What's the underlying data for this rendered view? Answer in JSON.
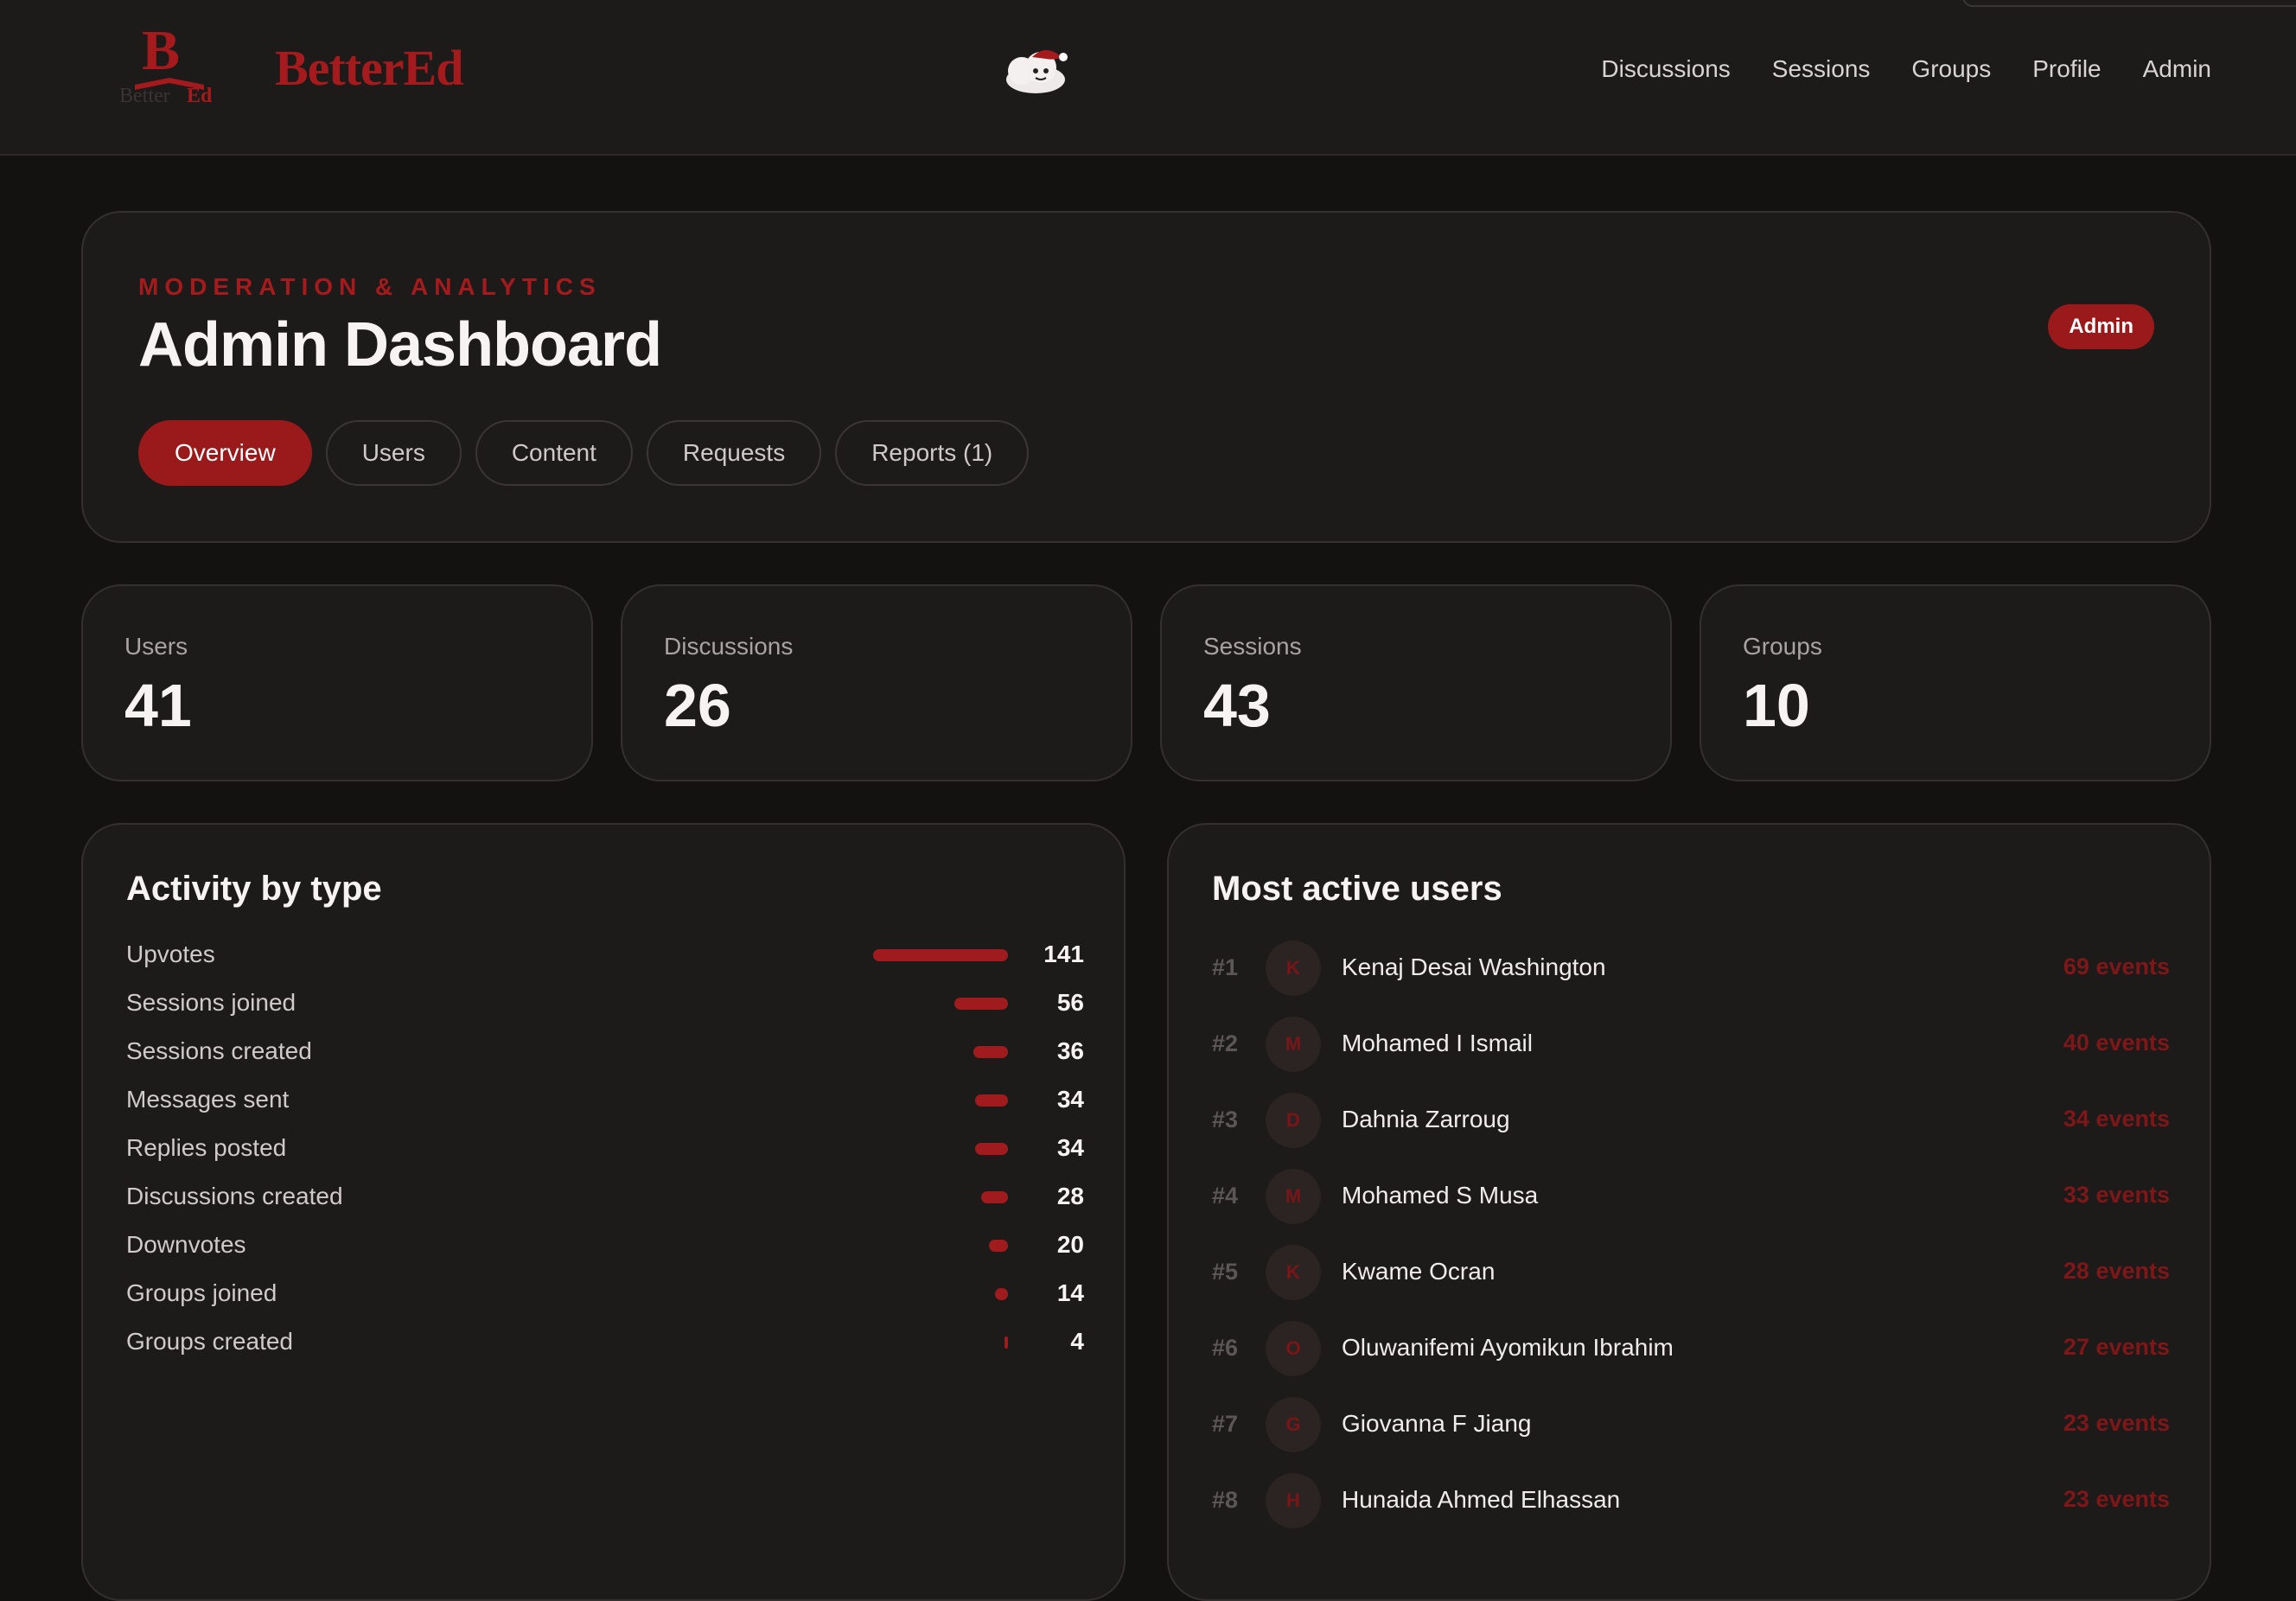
{
  "header": {
    "brand": "BetterEd",
    "nav": [
      "Discussions",
      "Sessions",
      "Groups",
      "Profile",
      "Admin"
    ]
  },
  "hero": {
    "eyebrow": "MODERATION & ANALYTICS",
    "title": "Admin Dashboard",
    "badge": "Admin",
    "tabs": [
      "Overview",
      "Users",
      "Content",
      "Requests",
      "Reports (1)"
    ],
    "active_tab": "Overview"
  },
  "stats": [
    {
      "label": "Users",
      "value": "41"
    },
    {
      "label": "Discussions",
      "value": "26"
    },
    {
      "label": "Sessions",
      "value": "43"
    },
    {
      "label": "Groups",
      "value": "10"
    }
  ],
  "activity": {
    "title": "Activity by type",
    "items": [
      {
        "label": "Upvotes",
        "value": 141
      },
      {
        "label": "Sessions joined",
        "value": 56
      },
      {
        "label": "Sessions created",
        "value": 36
      },
      {
        "label": "Messages sent",
        "value": 34
      },
      {
        "label": "Replies posted",
        "value": 34
      },
      {
        "label": "Discussions created",
        "value": 28
      },
      {
        "label": "Downvotes",
        "value": 20
      },
      {
        "label": "Groups joined",
        "value": 14
      },
      {
        "label": "Groups created",
        "value": 4
      }
    ]
  },
  "active_users": {
    "title": "Most active users",
    "items": [
      {
        "rank": "#1",
        "initial": "K",
        "name": "Kenaj Desai Washington",
        "events": "69 events"
      },
      {
        "rank": "#2",
        "initial": "M",
        "name": "Mohamed I Ismail",
        "events": "40 events"
      },
      {
        "rank": "#3",
        "initial": "D",
        "name": "Dahnia Zarroug",
        "events": "34 events"
      },
      {
        "rank": "#4",
        "initial": "M",
        "name": "Mohamed S Musa",
        "events": "33 events"
      },
      {
        "rank": "#5",
        "initial": "K",
        "name": "Kwame Ocran",
        "events": "28 events"
      },
      {
        "rank": "#6",
        "initial": "O",
        "name": "Oluwanifemi Ayomikun Ibrahim",
        "events": "27 events"
      },
      {
        "rank": "#7",
        "initial": "G",
        "name": "Giovanna F Jiang",
        "events": "23 events"
      },
      {
        "rank": "#8",
        "initial": "H",
        "name": "Hunaida Ahmed Elhassan",
        "events": "23 events"
      }
    ]
  },
  "colors": {
    "accent": "#9a1a1c",
    "background": "#141111",
    "surface": "#1d1a1a"
  }
}
